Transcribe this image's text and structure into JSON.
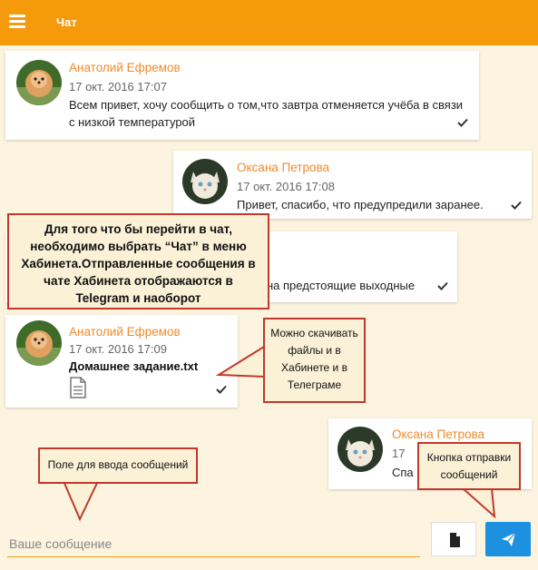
{
  "header": {
    "title": "Чат",
    "menu_icon": "hamburger-icon"
  },
  "messages": [
    {
      "sender": "Анатолий Ефремов",
      "time": "17 окт. 2016 17:07",
      "text": "Всем привет, хочу сообщить о том,что завтра отменяется учёба в связи с  низкой температурой"
    },
    {
      "sender": "Оксана Петрова",
      "time": "17 окт. 2016 17:08",
      "text": "Привет, спасибо, что предупредили заранее."
    },
    {
      "sender": "",
      "time": "",
      "text": "на предстоящие выходные"
    },
    {
      "sender": "Анатолий Ефремов",
      "time": "17 окт. 2016 17:09",
      "file": "Домашнее задание.txt"
    },
    {
      "sender": "Оксана Петрова",
      "time": "17",
      "text": "Спа"
    }
  ],
  "callouts": {
    "main": "Для того что бы перейти в чат, необходимо выбрать “Чат”  в меню Хабинета.Отправленные сообщения в чате Хабинета отображаются в Telegram и наоборот",
    "files": "Можно скачивать файлы и в Хабинете и в Телеграме",
    "input": "Поле для ввода сообщений",
    "send": "Кнопка отправки сообщений"
  },
  "composer": {
    "placeholder": "Ваше сообщение",
    "attach_icon": "file-icon",
    "send_icon": "paper-plane-icon"
  },
  "colors": {
    "accent": "#f59a0b",
    "sender": "#ef8b2c",
    "send_button": "#1e90e0",
    "callout_border": "#c0392b"
  }
}
